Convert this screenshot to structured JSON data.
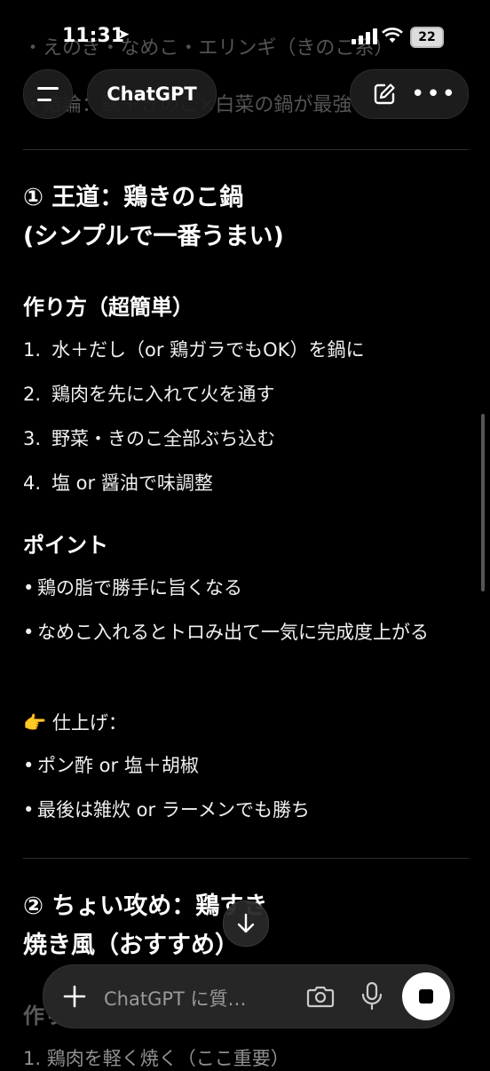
{
  "status_bar": {
    "time": "11:31",
    "battery": "22"
  },
  "background_text": {
    "line1": "・えのき・なめこ・エリンギ（きのこ系）",
    "line2": "・結論：鶏＋きのこ×白菜の鍋が最強"
  },
  "header": {
    "title": "ChatGPT"
  },
  "section1": {
    "heading_line1": "① 王道：鶏きのこ鍋",
    "heading_line2": "(シンプルで一番うまい)",
    "howto_heading": "作り方（超簡単）",
    "steps": [
      {
        "num": "1.",
        "text": "水＋だし（or 鶏ガラでもOK）を鍋に"
      },
      {
        "num": "2.",
        "text": "鶏肉を先に入れて火を通す"
      },
      {
        "num": "3.",
        "text": "野菜・きのこ全部ぶち込む"
      },
      {
        "num": "4.",
        "text": "塩 or 醤油で味調整"
      }
    ],
    "point_heading": "ポイント",
    "points": [
      "鶏の脂で勝手に旨くなる",
      "なめこ入れるとトロみ出て一気に完成度上がる"
    ],
    "finish_label": "👉 仕上げ：",
    "finish_items": [
      "ポン酢 or 塩＋胡椒",
      "最後は雑炊 or ラーメンでも勝ち"
    ]
  },
  "section2": {
    "heading_line1": "② ちょい攻め：鶏すき",
    "heading_line2": "焼き風（おすすめ）",
    "howto_heading_partial": "作り方",
    "step1_partial": "1. 鶏肉を軽く焼く（ここ重要）"
  },
  "composer": {
    "placeholder": "ChatGPT に質…"
  }
}
